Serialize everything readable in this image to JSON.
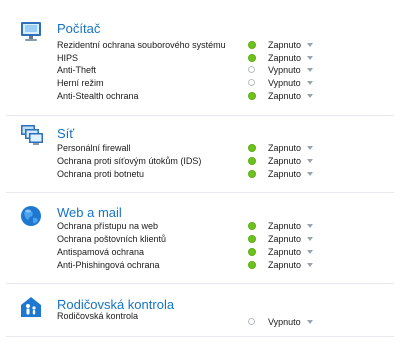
{
  "sections": [
    {
      "title": "Počítač",
      "icon": "monitor-icon",
      "items": [
        {
          "label": "Rezidentní ochrana souborového systému",
          "status": "Zapnuto",
          "on": true
        },
        {
          "label": "HIPS",
          "status": "Zapnuto",
          "on": true
        },
        {
          "label": "Anti-Theft",
          "status": "Vypnuto",
          "on": false
        },
        {
          "label": "Herní režim",
          "status": "Vypnuto",
          "on": false
        },
        {
          "label": "Anti-Stealth ochrana",
          "status": "Zapnuto",
          "on": true
        }
      ]
    },
    {
      "title": "Síť",
      "icon": "network-computers-icon",
      "items": [
        {
          "label": "Personální firewall",
          "status": "Zapnuto",
          "on": true
        },
        {
          "label": "Ochrana proti síťovým útokům (IDS)",
          "status": "Zapnuto",
          "on": true
        },
        {
          "label": "Ochrana proti botnetu",
          "status": "Zapnuto",
          "on": true
        }
      ]
    },
    {
      "title": "Web a mail",
      "icon": "globe-icon",
      "items": [
        {
          "label": "Ochrana přístupu na web",
          "status": "Zapnuto",
          "on": true
        },
        {
          "label": "Ochrana poštovních klientů",
          "status": "Zapnuto",
          "on": true
        },
        {
          "label": "Antispamová ochrana",
          "status": "Zapnuto",
          "on": true
        },
        {
          "label": "Anti-Phishingová ochrana",
          "status": "Zapnuto",
          "on": true
        }
      ]
    },
    {
      "title": "Rodičovská kontrola",
      "icon": "parental-control-icon",
      "items": [
        {
          "label": "Rodičovská kontrola",
          "status": "Vypnuto",
          "on": false
        }
      ]
    }
  ],
  "colors": {
    "title": "#1673c4",
    "status_on": "#6dc21e",
    "status_off_border": "#b9bec5",
    "divider": "#e6eaf0"
  }
}
